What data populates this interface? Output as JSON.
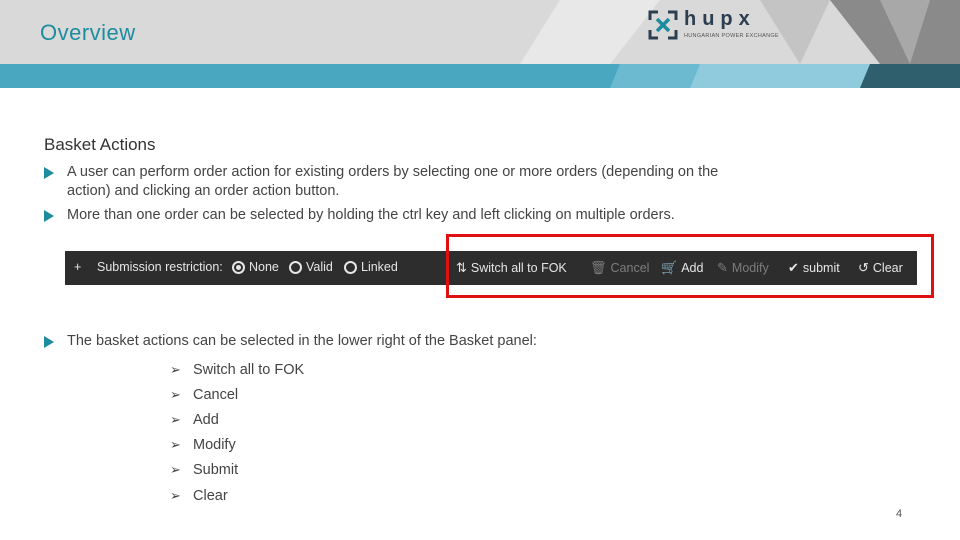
{
  "header": {
    "title": "Overview"
  },
  "logo": {
    "text": "hupx",
    "subtitle": "HUNGARIAN POWER EXCHANGE"
  },
  "section": {
    "title": "Basket Actions"
  },
  "bullets": [
    {
      "line1": "A user can perform order action for existing orders by selecting one or more orders (depending on the",
      "line2": "action) and clicking an order action button."
    },
    {
      "line1": "More than one order can be selected by holding the ctrl key and left clicking on multiple orders."
    },
    {
      "line1": "The basket actions can be selected in the lower right of the Basket panel:"
    }
  ],
  "toolbar": {
    "plus": "+",
    "restriction_label": "Submission restriction:",
    "options": [
      "None",
      "Valid",
      "Linked"
    ],
    "selected_option": "None",
    "actions": {
      "switch_fok": "Switch all to FOK",
      "cancel": "Cancel",
      "add": "Add",
      "modify": "Modify",
      "submit": "submit",
      "clear": "Clear"
    }
  },
  "actions_list": [
    "Switch all to FOK",
    "Cancel",
    "Add",
    "Modify",
    "Submit",
    "Clear"
  ],
  "page_number": "4",
  "colors": {
    "accent": "#1c8c9e",
    "bar": "#4aa7c0",
    "highlight": "#e01010",
    "toolbar_bg": "#2d2d2d"
  }
}
